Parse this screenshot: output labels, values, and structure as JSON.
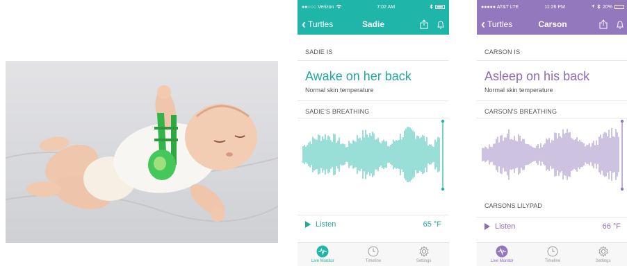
{
  "colors": {
    "sadie_accent": "#1fb5a8",
    "carson_accent": "#9478bd",
    "sock_green": "#33b34a"
  },
  "photo": {
    "alt": ""
  },
  "phones": [
    {
      "id": "sadie",
      "status": {
        "carrier": "●●○○○ Verizon",
        "wifi": "wifi-icon",
        "time": "7:02 AM",
        "bluetooth": "bluetooth-icon",
        "battery_level": 0.9
      },
      "nav": {
        "back": "Turtles",
        "title": "Sadie",
        "share_icon": "share-icon",
        "bell_icon": "bell-icon"
      },
      "state_label": "SADIE IS",
      "state": "Awake on her back",
      "skin": "Normal skin temperature",
      "breathing_label": "SADIE'S BREATHING",
      "footer_label": "",
      "listen": "Listen",
      "temperature": "65 °F",
      "tabs": [
        "Live Monitor",
        "Timeline",
        "Settings"
      ]
    },
    {
      "id": "carson",
      "status": {
        "carrier": "●●●●● AT&T  LTE",
        "wifi": "",
        "time": "11:26 PM",
        "bluetooth": "bluetooth-icon",
        "battery_text": "20%",
        "battery_level": 0.2
      },
      "nav": {
        "back": "Turtles",
        "title": "Carson",
        "share_icon": "share-icon",
        "bell_icon": "bell-icon"
      },
      "state_label": "CARSON IS",
      "state": "Asleep on his back",
      "skin": "Normal skin temperature",
      "breathing_label": "CARSON'S BREATHING",
      "footer_label": "CARSONS LILYPAD",
      "listen": "Listen",
      "temperature": "66 °F",
      "tabs": [
        "Live Monitor",
        "Timeline",
        "Settings"
      ]
    }
  ]
}
